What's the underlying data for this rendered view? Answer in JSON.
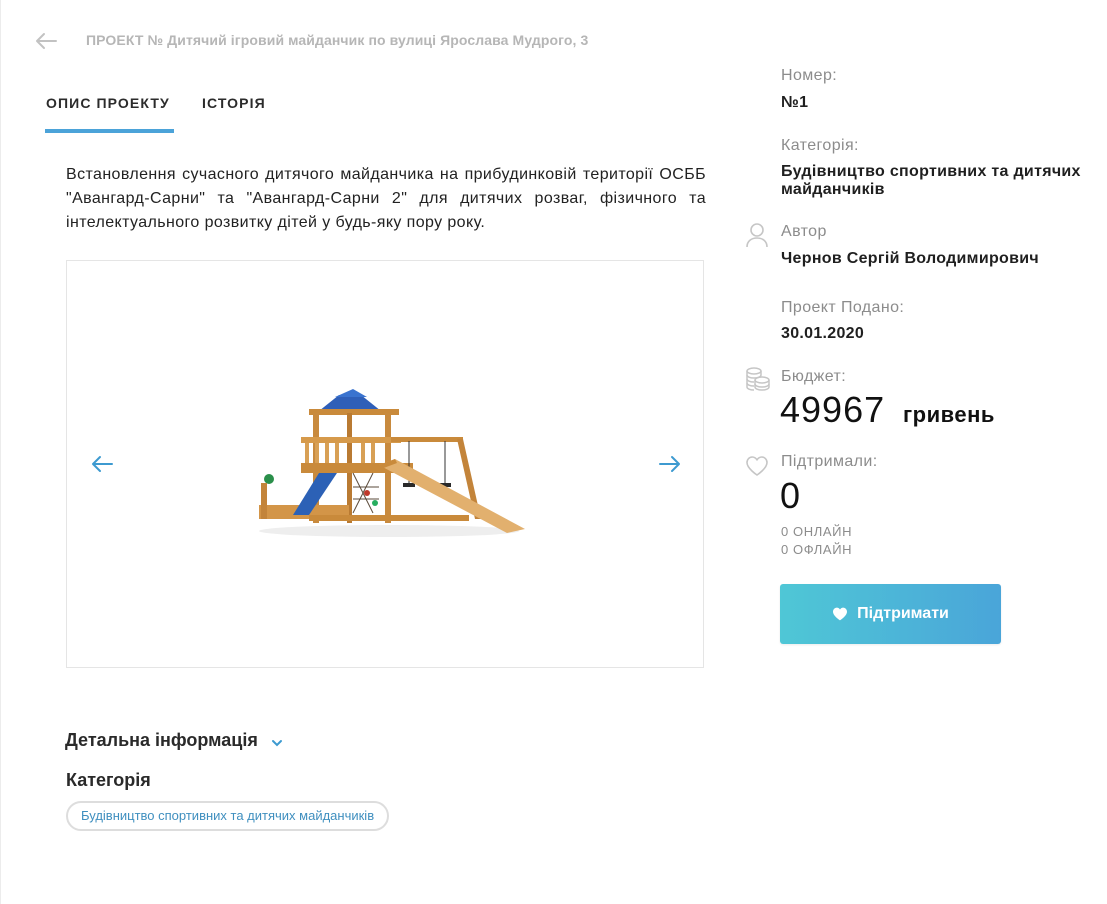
{
  "breadcrumb": {
    "text": "ПРОЕКТ № Дитячий ігровий майданчик по вулиці Ярослава Мудрого, 3"
  },
  "tabs": [
    {
      "label": "ОПИС ПРОЕКТУ",
      "active": true
    },
    {
      "label": "ІСТОРІЯ",
      "active": false
    }
  ],
  "description": "Встановлення сучасного дитячого майданчика на прибудинковій території ОСББ \"Авангард-Сарни\" та \"Авангард-Сарни 2\" для дитячих розваг, фізичного та інтелектуального розвитку дітей у будь-яку пору року.",
  "details": {
    "toggle_label": "Детальна інформація",
    "category_heading": "Категорія",
    "category_chip": "Будівництво спортивних та дитячих майданчиків"
  },
  "sidebar": {
    "number_label": "Номер:",
    "number_value": "№1",
    "category_label": "Категорія:",
    "category_value": "Будівництво спортивних та дитячих майданчиків",
    "author_label": "Автор",
    "author_value": "Чернов Сергій Володимирович",
    "submitted_label": "Проект Подано:",
    "submitted_value": "30.01.2020",
    "budget_label": "Бюджет:",
    "budget_value": "49967",
    "budget_unit": "гривень",
    "supported_label": "Підтримали:",
    "supported_value": "0",
    "online": "0 ОНЛАЙН",
    "offline": "0 ОФЛАЙН",
    "support_button": "Підтримати"
  },
  "colors": {
    "accent": "#4ba3d9",
    "button_gradient_start": "#4fc7d6",
    "button_gradient_end": "#4aa5d9",
    "muted_text": "#8c8c8c"
  },
  "icons": [
    "back-arrow-icon",
    "carousel-prev-icon",
    "carousel-next-icon",
    "chevron-down-icon",
    "user-icon",
    "coins-icon",
    "heart-outline-icon",
    "heart-icon"
  ]
}
